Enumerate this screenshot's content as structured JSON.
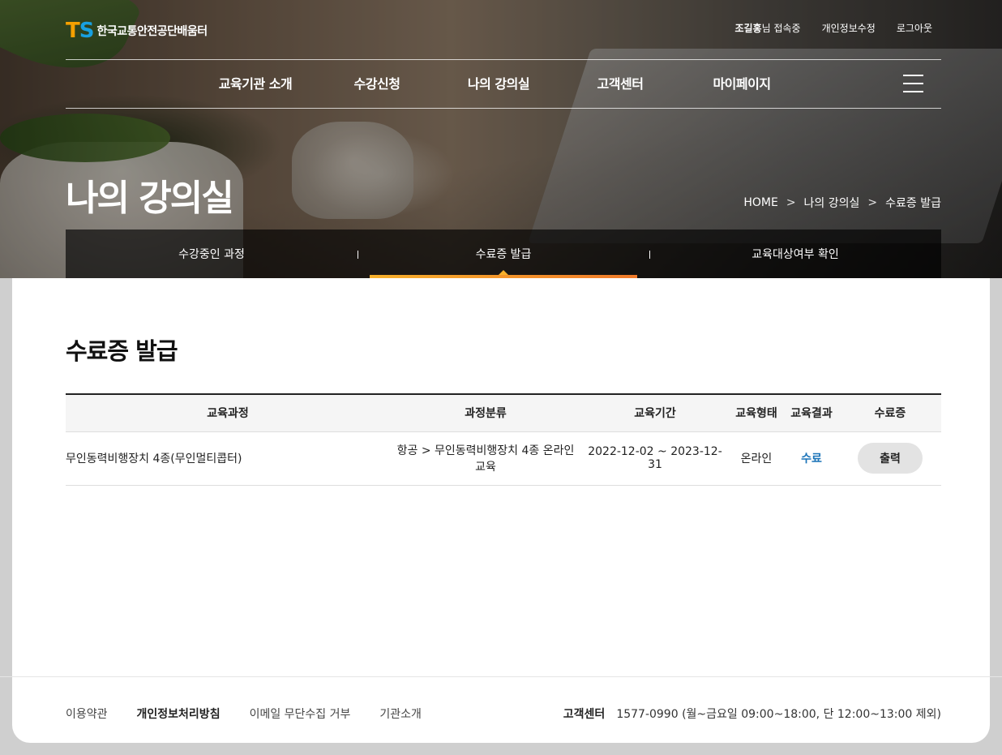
{
  "header": {
    "logo_mark_t": "T",
    "logo_mark_s": "S",
    "org_name": "한국교통안전공단배움터",
    "user_name": "조길홍",
    "user_suffix": "님 접속중",
    "edit_profile": "개인정보수정",
    "logout": "로그아웃"
  },
  "nav": {
    "items": [
      "교육기관 소개",
      "수강신청",
      "나의 강의실",
      "고객센터",
      "마이페이지"
    ]
  },
  "hero": {
    "title": "나의 강의실",
    "breadcrumb": [
      "HOME",
      "나의 강의실",
      "수료증 발급"
    ]
  },
  "tabs": [
    "수강중인 과정",
    "수료증 발급",
    "교육대상여부 확인"
  ],
  "section": {
    "title": "수료증 발급"
  },
  "table": {
    "headers": [
      "교육과정",
      "과정분류",
      "교육기간",
      "교육형태",
      "교육결과",
      "수료증"
    ],
    "rows": [
      {
        "course": "무인동력비행장치 4종(무인멀티콥터)",
        "category_line1": "항공 > 무인동력비행장치 4종 온라인",
        "category_line2": "교육",
        "period": "2022-12-02 ~ 2023-12-31",
        "type": "온라인",
        "result": "수료",
        "action": "출력"
      }
    ]
  },
  "footer": {
    "links": [
      "이용약관",
      "개인정보처리방침",
      "이메일 무단수집 거부",
      "기관소개"
    ],
    "contact_label": "고객센터",
    "phone": "1577-0990",
    "hours": "(월~금요일 09:00~18:00, 단 12:00~13:00 제외)"
  },
  "colors": {
    "accent_orange": "#f7b02b",
    "logo_t": "#f5a000",
    "logo_s": "#18a0e0",
    "result_blue": "#1a73b8"
  }
}
